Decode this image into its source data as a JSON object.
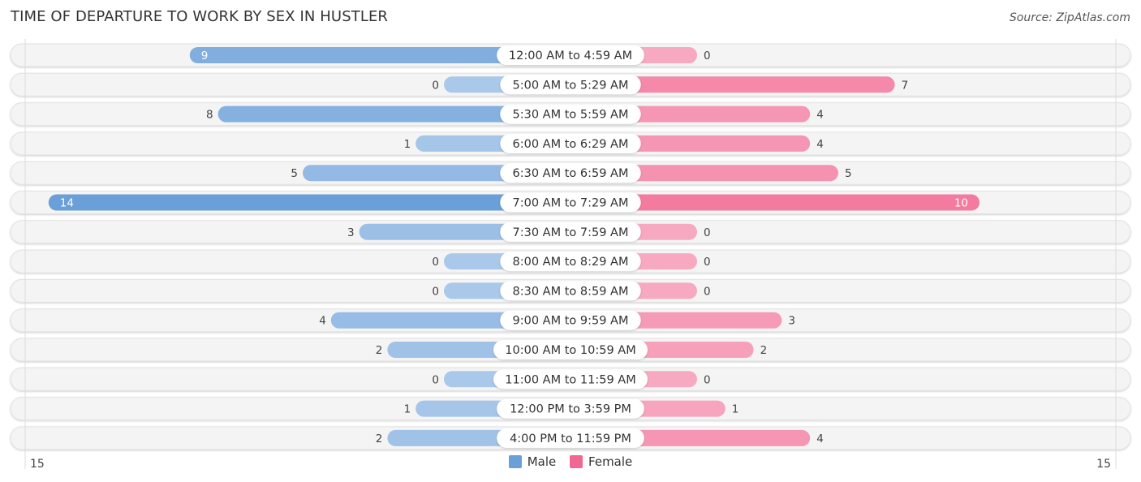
{
  "header": {
    "title": "TIME OF DEPARTURE TO WORK BY SEX IN HUSTLER",
    "source": "Source: ZipAtlas.com"
  },
  "colors": {
    "male": "#6a9fd8",
    "male_light": "#a9c8ea",
    "female": "#f06892",
    "female_light": "#f7a9c1",
    "row_bg": "#f4f4f4"
  },
  "chart_data": {
    "type": "bar",
    "orientation": "horizontal-diverging",
    "title": "TIME OF DEPARTURE TO WORK BY SEX IN HUSTLER",
    "categories": [
      "12:00 AM to 4:59 AM",
      "5:00 AM to 5:29 AM",
      "5:30 AM to 5:59 AM",
      "6:00 AM to 6:29 AM",
      "6:30 AM to 6:59 AM",
      "7:00 AM to 7:29 AM",
      "7:30 AM to 7:59 AM",
      "8:00 AM to 8:29 AM",
      "8:30 AM to 8:59 AM",
      "9:00 AM to 9:59 AM",
      "10:00 AM to 10:59 AM",
      "11:00 AM to 11:59 AM",
      "12:00 PM to 3:59 PM",
      "4:00 PM to 11:59 PM"
    ],
    "series": [
      {
        "name": "Male",
        "values": [
          9,
          0,
          8,
          1,
          5,
          14,
          3,
          0,
          0,
          4,
          2,
          0,
          1,
          2
        ]
      },
      {
        "name": "Female",
        "values": [
          0,
          7,
          4,
          4,
          5,
          10,
          0,
          0,
          0,
          3,
          2,
          0,
          1,
          4
        ]
      }
    ],
    "axis": {
      "left_tick": "15",
      "right_tick": "15",
      "range": [
        0,
        15
      ]
    },
    "legend": {
      "position": "bottom-center",
      "entries": [
        "Male",
        "Female"
      ]
    },
    "xlabel": "",
    "ylabel": ""
  }
}
